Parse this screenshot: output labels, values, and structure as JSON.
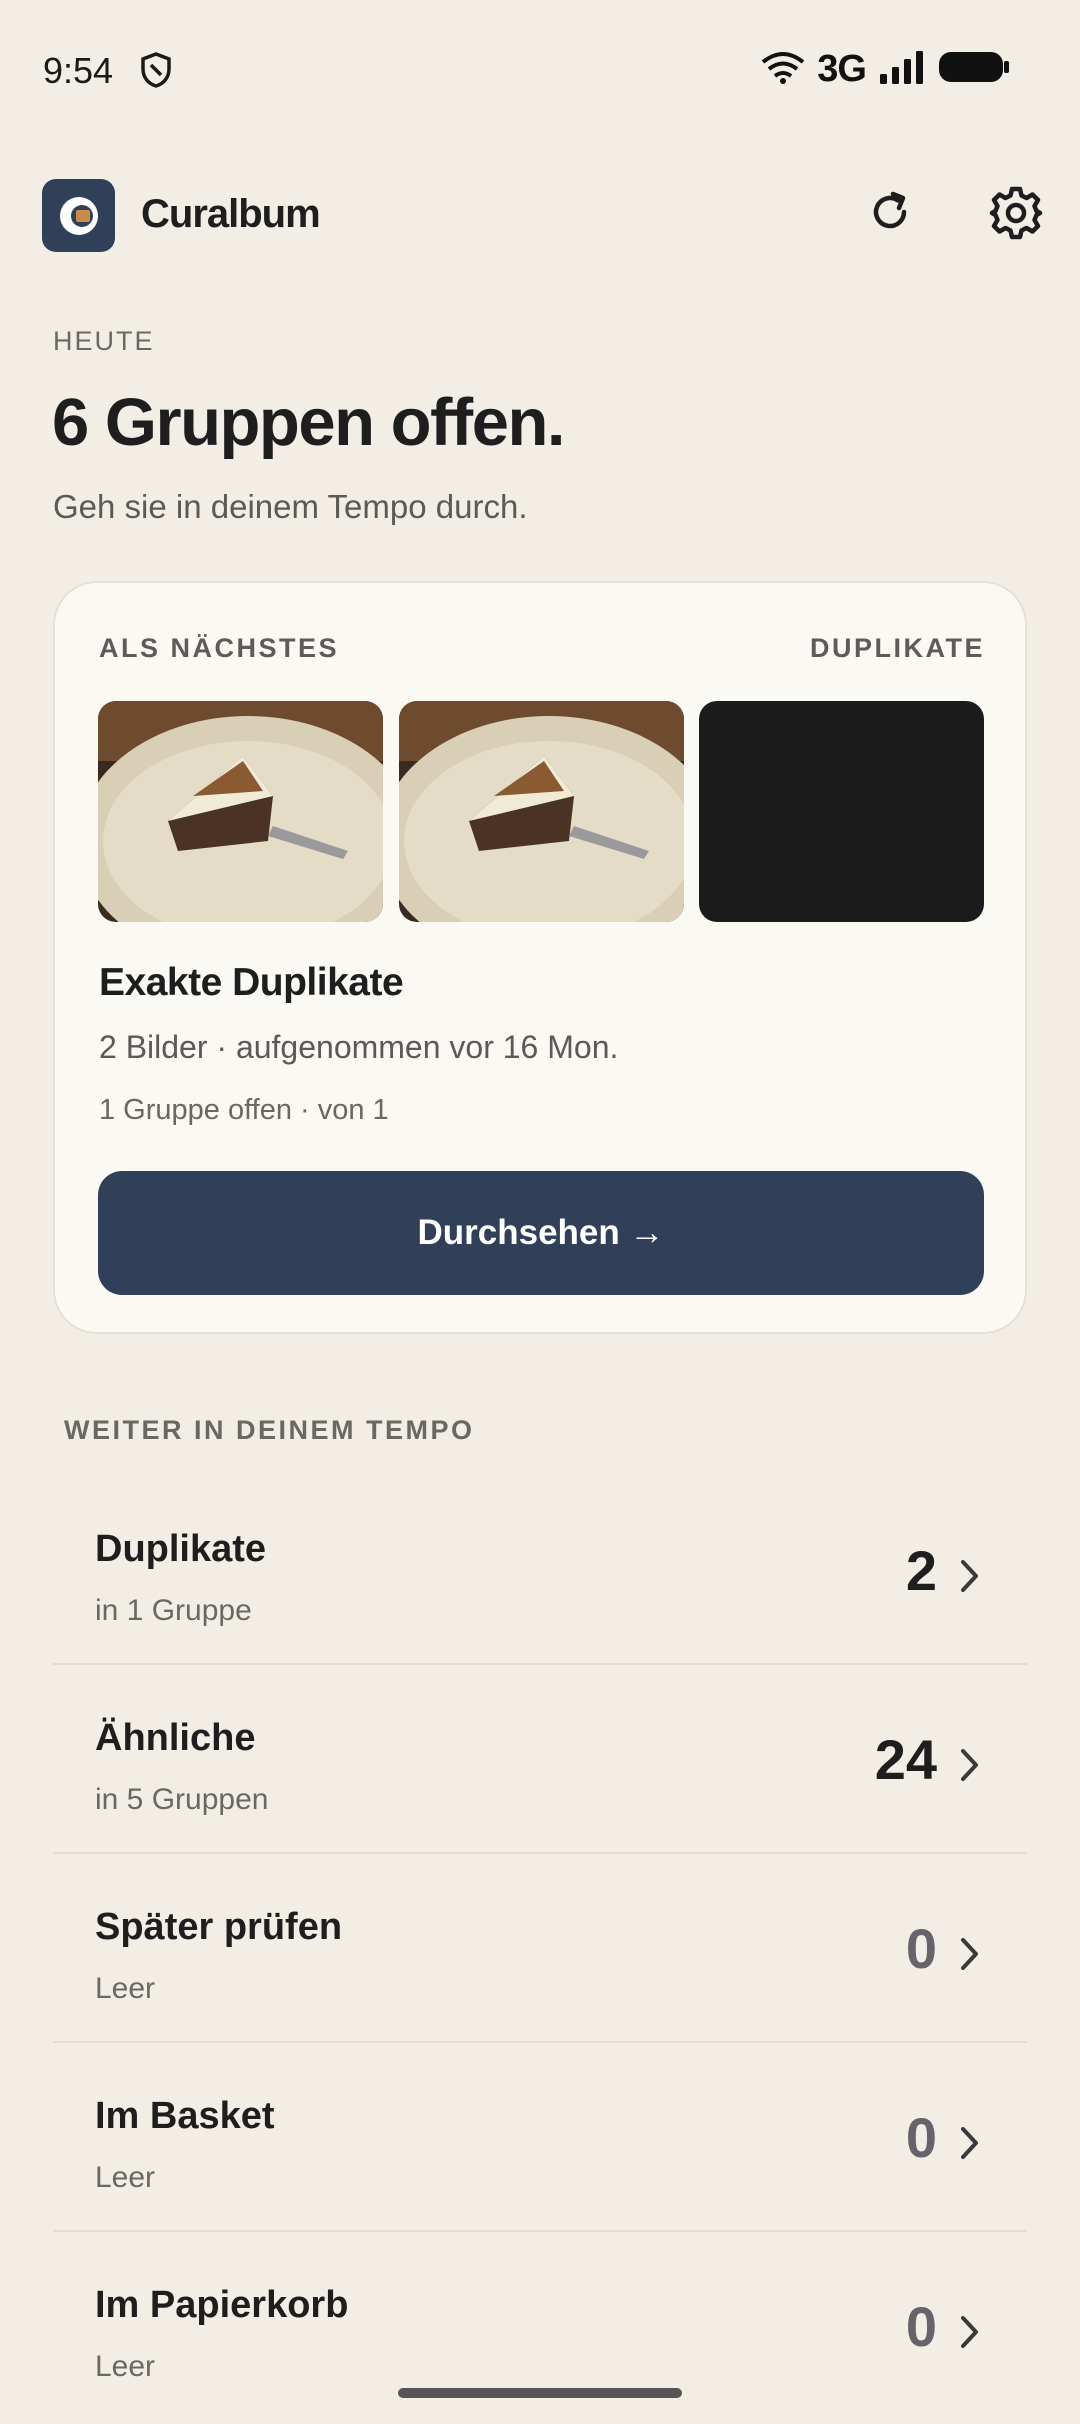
{
  "status_bar": {
    "time": "9:54",
    "network": "3G"
  },
  "app": {
    "title": "Curalbum",
    "accent_color": "#2f4058"
  },
  "today": {
    "eyebrow": "HEUTE",
    "headline": "6 Gruppen offen.",
    "subline": "Geh sie in deinem Tempo durch."
  },
  "next_card": {
    "eyebrow_left": "ALS NÄCHSTES",
    "eyebrow_right": "DUPLIKATE",
    "title": "Exakte Duplikate",
    "meta": "2 Bilder · aufgenommen vor 16 Mon.",
    "progress": "1 Gruppe offen · von 1",
    "button_label": "Durchsehen →",
    "thumbnails": [
      "cake-photo",
      "cake-photo",
      "dark-photo"
    ]
  },
  "section": {
    "label": "WEITER IN DEINEM TEMPO"
  },
  "list": [
    {
      "title": "Duplikate",
      "subtitle": "in 1 Gruppe",
      "count": "2"
    },
    {
      "title": "Ähnliche",
      "subtitle": "in 5 Gruppen",
      "count": "24"
    },
    {
      "title": "Später prüfen",
      "subtitle": "Leer",
      "count": "0"
    },
    {
      "title": "Im Basket",
      "subtitle": "Leer",
      "count": "0"
    },
    {
      "title": "Im Papierkorb",
      "subtitle": "Leer",
      "count": "0"
    }
  ]
}
